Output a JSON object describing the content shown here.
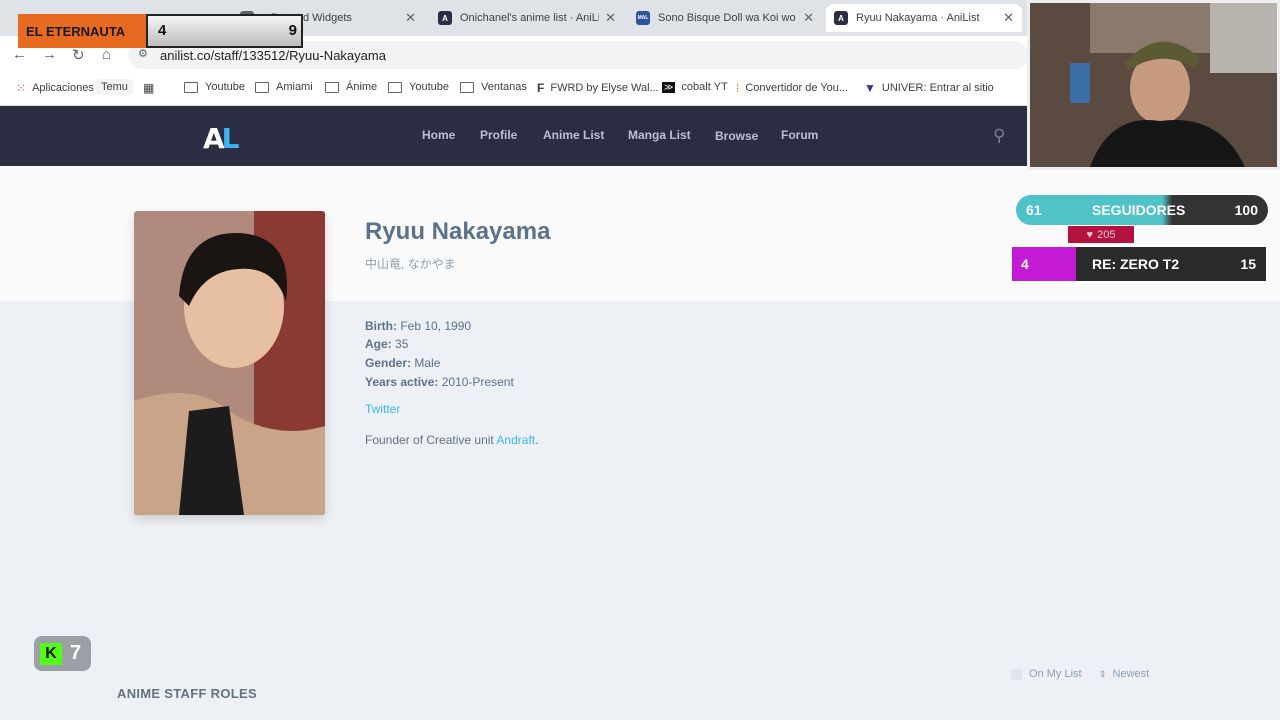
{
  "browser": {
    "tabs": [
      {
        "title": "atBot and Widgets",
        "favicon": "W",
        "favicon_color": "#5f6368"
      },
      {
        "title": "Onichanel's anime list · AniList",
        "favicon": "A",
        "favicon_color": "#2b2d42"
      },
      {
        "title": "Sono Bisque Doll wa Koi wo Su",
        "favicon": "MAL",
        "favicon_color": "#2e51a2"
      },
      {
        "title": "Ryuu Nakayama · AniList",
        "favicon": "A",
        "favicon_color": "#2b2d42",
        "active": true
      }
    ],
    "url": "anilist.co/staff/133512/Ryuu-Nakayama",
    "bookmarks": [
      {
        "label": "Aplicaciones",
        "icon": "apps-grid"
      },
      {
        "label": "Temu",
        "icon": "none"
      },
      {
        "label": "",
        "icon": "grid"
      },
      {
        "label": "Youtube",
        "icon": "folder"
      },
      {
        "label": "Amiami",
        "icon": "folder"
      },
      {
        "label": "Ánime",
        "icon": "folder"
      },
      {
        "label": "Youtube",
        "icon": "folder"
      },
      {
        "label": "Ventanas",
        "icon": "folder"
      },
      {
        "label": "FWRD by Elyse Wal...",
        "icon": "F"
      },
      {
        "label": "cobalt YT",
        "icon": "cobalt"
      },
      {
        "label": "Convertidor de You...",
        "icon": "wave"
      },
      {
        "label": "UNIVER: Entrar al sitio",
        "icon": "V"
      }
    ]
  },
  "anilist": {
    "logo": "AL",
    "nav": [
      "Home",
      "Profile",
      "Anime List",
      "Manga List",
      "Browse",
      "Forum"
    ]
  },
  "staff": {
    "name": "Ryuu Nakayama",
    "native_name": "中山竜, なかやま",
    "birth_label": "Birth:",
    "birth": "Feb 10, 1990",
    "age_label": "Age:",
    "age": "35",
    "gender_label": "Gender:",
    "gender": "Male",
    "years_label": "Years active:",
    "years": "2010-Present",
    "twitter": "Twitter",
    "bio_prefix": "Founder of Creative unit ",
    "bio_link": "Andraft",
    "bio_suffix": "."
  },
  "roles": {
    "title": "ANIME STAFF ROLES",
    "filter_mylist": "On My List",
    "sort": "Newest"
  },
  "overlays": {
    "eternauta_label": "EL ETERNAUTA",
    "eternauta_left": "4",
    "eternauta_right": "9",
    "followers_current": "61",
    "followers_label": "SEGUIDORES",
    "followers_goal": "100",
    "likes": "205",
    "rezero_left": "4",
    "rezero_label": "RE: ZERO T2",
    "rezero_right": "15",
    "kick_count": "7",
    "kick_letter": "K"
  }
}
